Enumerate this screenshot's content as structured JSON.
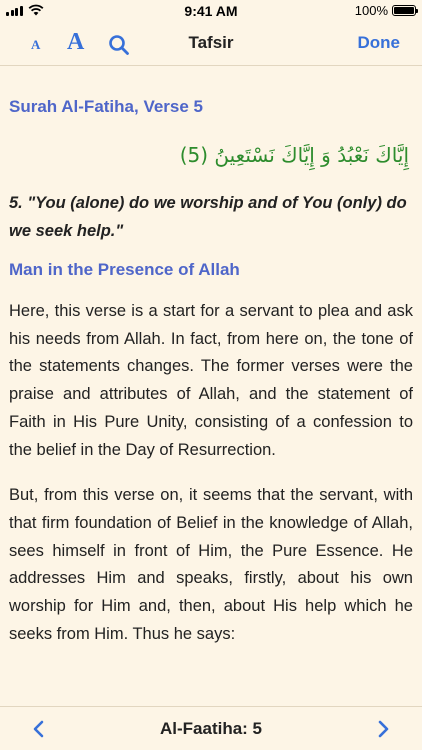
{
  "status_bar": {
    "time": "9:41 AM",
    "battery": "100%"
  },
  "nav": {
    "font_small_label": "A",
    "font_large_label": "A",
    "title": "Tafsir",
    "done_label": "Done"
  },
  "content": {
    "surah_heading": "Surah Al-Fatiha, Verse 5",
    "arabic_verse": "إِيَّاكَ نَعْبُدُ وَ إِيَّاكَ نَسْتَعِينُ (5)",
    "translation": "5. \"You (alone) do we worship and of You (only) do we seek help.\"",
    "section_heading": "Man in the Presence of Allah",
    "paragraphs": [
      "Here, this verse is a start for a servant to plea and ask his needs from Allah. In fact, from here on, the tone of the statements changes. The former verses were the praise and attributes of Allah, and the statement of Faith in His Pure Unity, consisting of a confession to the belief in the Day of Resurrection.",
      "But, from this verse on, it seems that the servant, with that firm foundation of Belief in the knowledge of Allah, sees himself in front of Him, the Pure Essence. He addresses Him and speaks, firstly, about his own worship for Him and, then, about His help which he seeks from Him. Thus he says:"
    ]
  },
  "toolbar": {
    "location": "Al-Faatiha: 5"
  },
  "colors": {
    "accent": "#3770d9",
    "heading": "#4f66c9",
    "arabic": "#2d8c2d",
    "background": "#fdf5e6"
  },
  "icons": {
    "signal": "signal-bars-icon",
    "wifi": "wifi-icon",
    "battery": "battery-icon",
    "search": "search-icon",
    "prev": "chevron-left-icon",
    "next": "chevron-right-icon"
  }
}
